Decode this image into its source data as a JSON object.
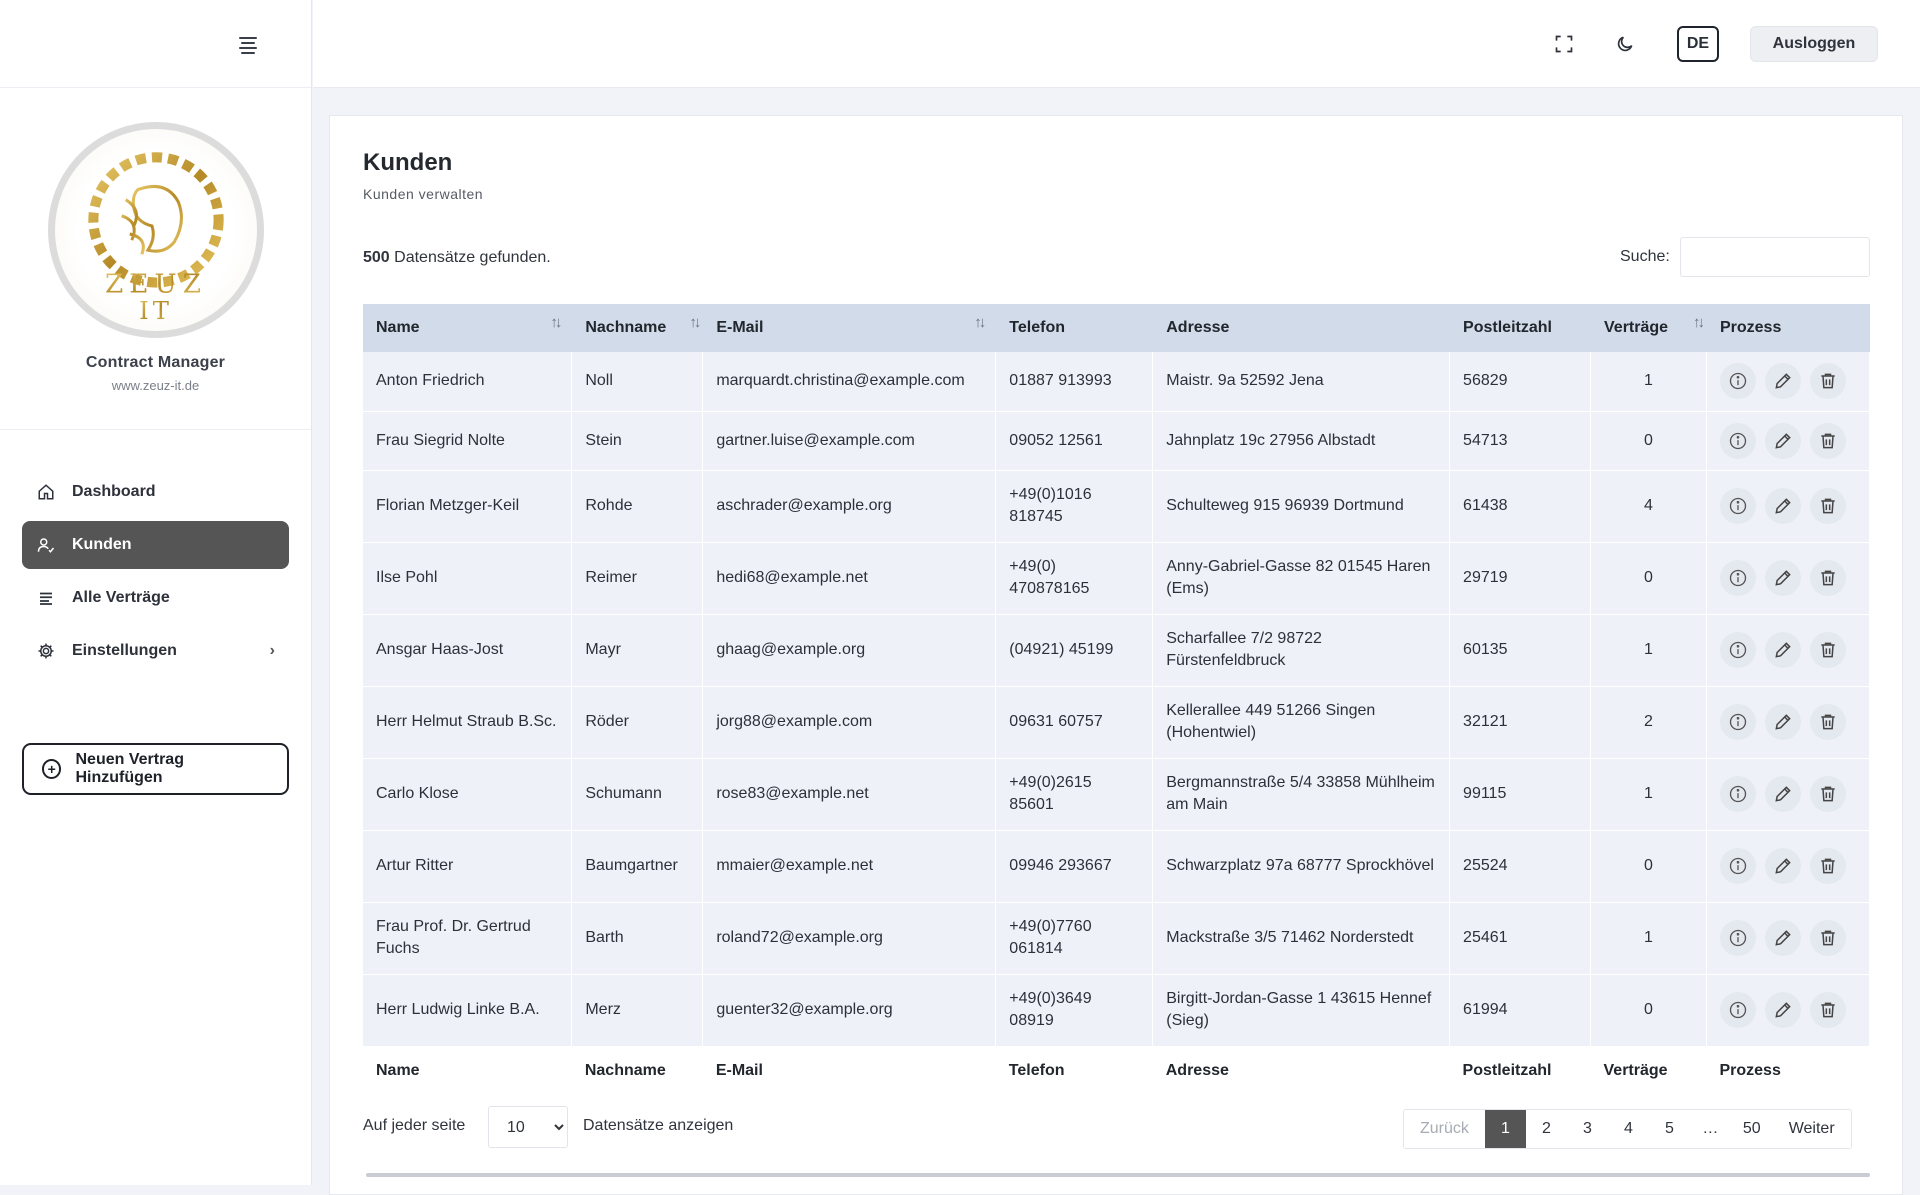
{
  "brand": {
    "name": "Contract Manager",
    "url": "www.zeuz-it.de",
    "logo_text_top": "ZEUZ",
    "logo_text_bottom": "IT"
  },
  "nav": {
    "items": [
      {
        "label": "Dashboard",
        "icon": "home-icon"
      },
      {
        "label": "Kunden",
        "icon": "user-check-icon"
      },
      {
        "label": "Alle Verträge",
        "icon": "list-icon"
      },
      {
        "label": "Einstellungen",
        "icon": "gear-icon"
      }
    ],
    "add_contract": "Neuen Vertrag Hinzufügen"
  },
  "topbar": {
    "lang": "DE",
    "logout": "Ausloggen"
  },
  "page": {
    "title": "Kunden",
    "subtitle": "Kunden verwalten"
  },
  "records": {
    "count": "500",
    "suffix": "Datensätze gefunden."
  },
  "search": {
    "label": "Suche:",
    "value": ""
  },
  "table": {
    "headers": [
      "Name",
      "Nachname",
      "E-Mail",
      "Telefon",
      "Adresse",
      "Postleitzahl",
      "Verträge",
      "Prozess"
    ],
    "rows": [
      [
        "Anton Friedrich",
        "Noll",
        "marquardt.christina@example.com",
        "01887 913993",
        "Maistr. 9a 52592 Jena",
        "56829",
        "1"
      ],
      [
        "Frau Siegrid Nolte",
        "Stein",
        "gartner.luise@example.com",
        "09052 12561",
        "Jahnplatz 19c 27956 Albstadt",
        "54713",
        "0"
      ],
      [
        "Florian Metzger-Keil",
        "Rohde",
        "aschrader@example.org",
        "+49(0)1016 818745",
        "Schulteweg 915 96939 Dortmund",
        "61438",
        "4"
      ],
      [
        "Ilse Pohl",
        "Reimer",
        "hedi68@example.net",
        "+49(0) 470878165",
        "Anny-Gabriel-Gasse 82 01545 Haren (Ems)",
        "29719",
        "0"
      ],
      [
        "Ansgar Haas-Jost",
        "Mayr",
        "ghaag@example.org",
        "(04921) 45199",
        "Scharfallee 7/2 98722 Fürstenfeldbruck",
        "60135",
        "1"
      ],
      [
        "Herr Helmut Straub B.Sc.",
        "Röder",
        "jorg88@example.com",
        "09631 60757",
        "Kellerallee 449 51266 Singen (Hohentwiel)",
        "32121",
        "2"
      ],
      [
        "Carlo Klose",
        "Schumann",
        "rose83@example.net",
        "+49(0)2615 85601",
        "Bergmannstraße 5/4 33858 Mühlheim am Main",
        "99115",
        "1"
      ],
      [
        "Artur Ritter",
        "Baumgartner",
        "mmaier@example.net",
        "09946 293667",
        "Schwarzplatz 97a 68777 Sprockhövel",
        "25524",
        "0"
      ],
      [
        "Frau Prof. Dr. Gertrud Fuchs",
        "Barth",
        "roland72@example.org",
        "+49(0)7760 061814",
        "Mackstraße 3/5 71462 Norderstedt",
        "25461",
        "1"
      ],
      [
        "Herr Ludwig Linke B.A.",
        "Merz",
        "guenter32@example.org",
        "+49(0)3649 08919",
        "Birgitt-Jordan-Gasse 1 43615 Hennef (Sieg)",
        "61994",
        "0"
      ]
    ]
  },
  "footer": {
    "perpage_label": "Auf jeder seite",
    "perpage_value": "10",
    "perpage_after": "Datensätze anzeigen",
    "pager": {
      "prev": "Zurück",
      "pages": [
        "1",
        "2",
        "3",
        "4",
        "5"
      ],
      "ellipsis": "…",
      "last": "50",
      "next": "Weiter",
      "active": "1"
    }
  },
  "colors": {
    "header_bg": "#d2dbea",
    "row_bg": "#eef2f8",
    "active_nav": "#555555",
    "logo_gold": "#c9a23a"
  }
}
